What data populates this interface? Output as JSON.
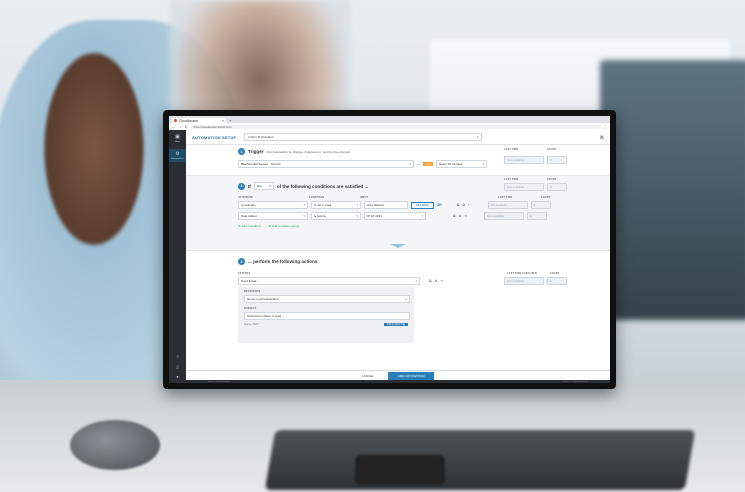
{
  "browser": {
    "tab_title": "Cloudlocator",
    "url": "https://cloudlocator.infsoft.com/"
  },
  "sidebar": {
    "items": [
      {
        "label": "Maps"
      },
      {
        "label": "Automations"
      }
    ]
  },
  "header": {
    "title": "AUTOMATION SETUP",
    "name_value": "Inform Technicians"
  },
  "trigger": {
    "num": "1",
    "title": "Trigger",
    "subtitle": "Run Automation by change of element or / and by time interval:",
    "element": "BlueSensEX Sensor",
    "op": "Grid ID",
    "every_tag": "every",
    "interval": "Every 15 minutes",
    "last_time_label": "LAST TIME",
    "count_label": "COUNT",
    "last_time_value": "Not available",
    "count_value": "0"
  },
  "conditions": {
    "num": "2",
    "if_label": "If",
    "any_value": "any",
    "rest": "of the following conditions are satisfied ...",
    "col_attribute": "ATTRIBUTE",
    "col_condition": "CONDITION",
    "col_input": "INPUT",
    "col_last_time": "LAST TIME",
    "col_count": "COUNT",
    "rows": [
      {
        "attribute": "Coordinate",
        "condition": "is not in area",
        "input": "area defined",
        "button": "SET AREA",
        "logic": "OR",
        "last": "Not available",
        "count": "0"
      },
      {
        "attribute": "Date Added",
        "condition": "is before",
        "input": "07.07.2021",
        "button": "",
        "logic": "",
        "last": "Not available",
        "count": "0"
      }
    ],
    "add_condition": "Add Condition",
    "add_group": "Add Condition group",
    "top_last_value": "Not available",
    "top_count_value": "0"
  },
  "actions": {
    "num": "3",
    "title": "... perform the following actions",
    "col_actions": "ACTIONS",
    "col_last_time": "LAST TIME EXECUTED",
    "col_count": "COUNT",
    "action": "Send Email",
    "last_value": "Not available",
    "count_value": "0",
    "recipients_label": "RECIPIENTS",
    "recipients_value": "Group to all technicians",
    "subject_label": "SUBJECT",
    "subject_value": "Technical problem in area",
    "source_label": "Source: TEXT",
    "add_dynamic": "Add dynamic Tag"
  },
  "footer": {
    "cancel": "CANCEL",
    "add": "ADD AUTOMATION"
  },
  "status": {
    "left": "infsoft · Location Intelligence",
    "right": "Version 1.0 · Powered by infsoft"
  }
}
